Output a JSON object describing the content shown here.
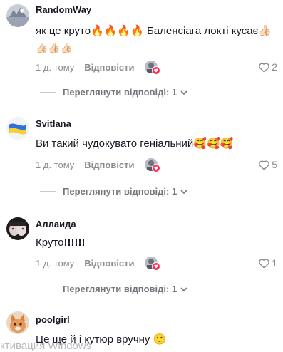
{
  "comments": [
    {
      "username": "RandomWay",
      "text_line1": "як це круто🔥🔥🔥🔥 Баленсіага локті кусає👍🏻",
      "text_line2": "👍🏻👍🏻👍🏻",
      "age": "1 д. тому",
      "reply_label": "Відповісти",
      "likes": "2",
      "view_replies": "Переглянути відповіді: 1"
    },
    {
      "username": "Svitlana",
      "text_line1": "Ви такий чудокувато геніальний🥰🥰🥰",
      "age": "1 д. тому",
      "reply_label": "Відповісти",
      "likes": "5",
      "view_replies": "Переглянути відповіді: 1"
    },
    {
      "username": "Аллаида",
      "text_line1": "Круто",
      "text_line1_bold": "!!!!!!",
      "age": "1 д. тому",
      "reply_label": "Відповісти",
      "likes": "1",
      "view_replies": "Переглянути відповіді: 1"
    },
    {
      "username": "poolgirl",
      "text_line1": "Це ще й і кутюр вручну 🙂"
    }
  ],
  "watermark": "ктивация Windows",
  "colors": {
    "text": "#161823",
    "muted": "#8a8b91",
    "accent": "#fe2c55"
  }
}
